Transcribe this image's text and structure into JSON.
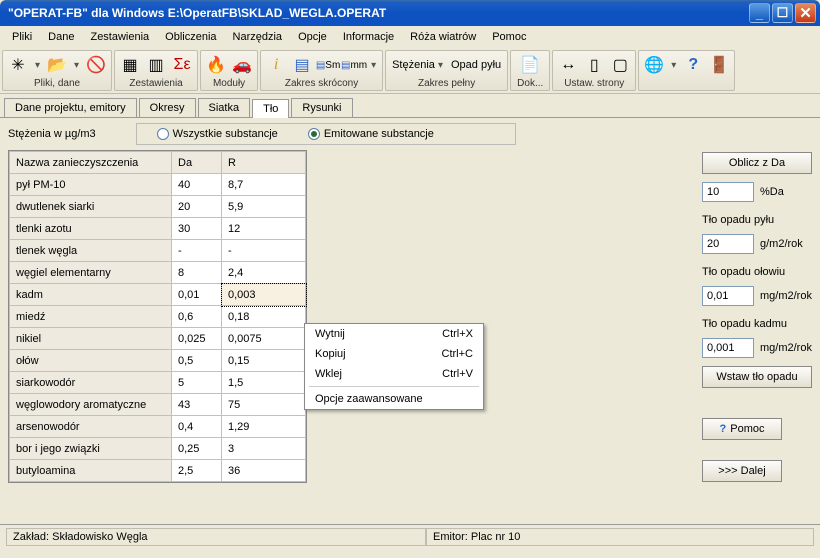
{
  "window": {
    "title": "\"OPERAT-FB\" dla Windows  E:\\OperatFB\\SKLAD_WEGLA.OPERAT"
  },
  "menu": [
    "Pliki",
    "Dane",
    "Zestawienia",
    "Obliczenia",
    "Narzędzia",
    "Opcje",
    "Informacje",
    "Róża wiatrów",
    "Pomoc"
  ],
  "toolbar_groups": [
    {
      "label": "Pliki, dane"
    },
    {
      "label": "Zestawienia"
    },
    {
      "label": "Moduły"
    },
    {
      "label": "Zakres skrócony"
    },
    {
      "label_a": "Stężenia",
      "label_b": "Opad pyłu",
      "label": "Zakres pełny"
    },
    {
      "label": "Dok..."
    },
    {
      "label": "Ustaw. strony"
    },
    {
      "label": ""
    }
  ],
  "tabs": [
    "Dane projektu, emitory",
    "Okresy",
    "Siatka",
    "Tło",
    "Rysunki"
  ],
  "active_tab": 3,
  "filter": {
    "label": "Stężenia w µg/m3",
    "opt1": "Wszystkie substancje",
    "opt2": "Emitowane substancje",
    "selected": 2
  },
  "grid": {
    "cols": [
      "Nazwa zanieczyszczenia",
      "Da",
      "R"
    ],
    "rows": [
      {
        "name": "pył PM-10",
        "da": "40",
        "r": "8,7"
      },
      {
        "name": "dwutlenek siarki",
        "da": "20",
        "r": "5,9"
      },
      {
        "name": "tlenki azotu",
        "da": "30",
        "r": "12"
      },
      {
        "name": "tlenek węgla",
        "da": "-",
        "r": "-"
      },
      {
        "name": "węgiel elementarny",
        "da": "8",
        "r": "2,4"
      },
      {
        "name": "kadm",
        "da": "0,01",
        "r": "0,003"
      },
      {
        "name": "miedź",
        "da": "0,6",
        "r": "0,18"
      },
      {
        "name": "nikiel",
        "da": "0,025",
        "r": "0,0075"
      },
      {
        "name": "ołów",
        "da": "0,5",
        "r": "0,15"
      },
      {
        "name": "siarkowodór",
        "da": "5",
        "r": "1,5"
      },
      {
        "name": "węglowodory aromatyczne",
        "da": "43",
        "r": "75"
      },
      {
        "name": "arsenowodór",
        "da": "0,4",
        "r": "1,29"
      },
      {
        "name": "bor i jego związki",
        "da": "0,25",
        "r": "3"
      },
      {
        "name": "butyloamina",
        "da": "2,5",
        "r": "36"
      }
    ],
    "selected_row": 5
  },
  "contextmenu": {
    "items": [
      {
        "label": "Wytnij",
        "shortcut": "Ctrl+X"
      },
      {
        "label": "Kopiuj",
        "shortcut": "Ctrl+C"
      },
      {
        "label": "Wklej",
        "shortcut": "Ctrl+V"
      }
    ],
    "adv": "Opcje zaawansowane"
  },
  "side": {
    "btn_oblicz": "Oblicz z Da",
    "pct_da_val": "10",
    "pct_da_unit": "%Da",
    "lbl_pylu": "Tło opadu pyłu",
    "val_pylu": "20",
    "unit_pylu": "g/m2/rok",
    "lbl_olowiu": "Tło opadu ołowiu",
    "val_olowiu": "0,01",
    "unit_olowiu": "mg/m2/rok",
    "lbl_kadmu": "Tło opadu kadmu",
    "val_kadmu": "0,001",
    "unit_kadmu": "mg/m2/rok",
    "btn_wstaw": "Wstaw tło opadu",
    "btn_pomoc": "Pomoc",
    "btn_dalej": ">>> Dalej"
  },
  "status": {
    "left": "Zakład: Składowisko Węgla",
    "right": "Emitor: Plac nr 10"
  }
}
